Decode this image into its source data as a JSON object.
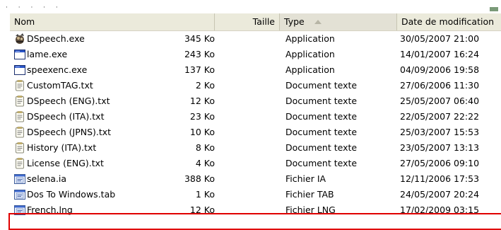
{
  "header": {
    "name": "Nom",
    "size": "Taille",
    "type": "Type",
    "date": "Date de modification",
    "sorted_column": "type",
    "sort_direction": "ascending"
  },
  "files": [
    {
      "name": "DSpeech.exe",
      "size": "345 Ko",
      "type": "Application",
      "date": "30/05/2007 21:00",
      "icon": "app-icon"
    },
    {
      "name": "lame.exe",
      "size": "243 Ko",
      "type": "Application",
      "date": "14/01/2007 16:24",
      "icon": "window-icon"
    },
    {
      "name": "speexenc.exe",
      "size": "137 Ko",
      "type": "Application",
      "date": "04/09/2006 19:58",
      "icon": "window-icon"
    },
    {
      "name": "CustomTAG.txt",
      "size": "2 Ko",
      "type": "Document texte",
      "date": "27/06/2006 11:30",
      "icon": "text-file-icon"
    },
    {
      "name": "DSpeech (ENG).txt",
      "size": "12 Ko",
      "type": "Document texte",
      "date": "25/05/2007 06:40",
      "icon": "text-file-icon"
    },
    {
      "name": "DSpeech (ITA).txt",
      "size": "23 Ko",
      "type": "Document texte",
      "date": "22/05/2007 22:22",
      "icon": "text-file-icon"
    },
    {
      "name": "DSpeech (JPNS).txt",
      "size": "10 Ko",
      "type": "Document texte",
      "date": "25/03/2007 15:53",
      "icon": "text-file-icon"
    },
    {
      "name": "History (ITA).txt",
      "size": "8 Ko",
      "type": "Document texte",
      "date": "23/05/2007 13:13",
      "icon": "text-file-icon"
    },
    {
      "name": "License (ENG).txt",
      "size": "4 Ko",
      "type": "Document texte",
      "date": "27/05/2006 09:10",
      "icon": "text-file-icon"
    },
    {
      "name": "selena.ia",
      "size": "388 Ko",
      "type": "Fichier IA",
      "date": "12/11/2006 17:53",
      "icon": "generic-file-icon"
    },
    {
      "name": "Dos To Windows.tab",
      "size": "1 Ko",
      "type": "Fichier TAB",
      "date": "24/05/2007 20:24",
      "icon": "generic-file-icon"
    },
    {
      "name": "French.lng",
      "size": "12 Ko",
      "type": "Fichier LNG",
      "date": "17/02/2009 03:15",
      "icon": "generic-file-icon",
      "highlighted": true
    }
  ],
  "colors": {
    "header_bg": "#ebeadb",
    "highlight_border": "#e00000",
    "window_icon_titlebar": "#2a55c8"
  }
}
